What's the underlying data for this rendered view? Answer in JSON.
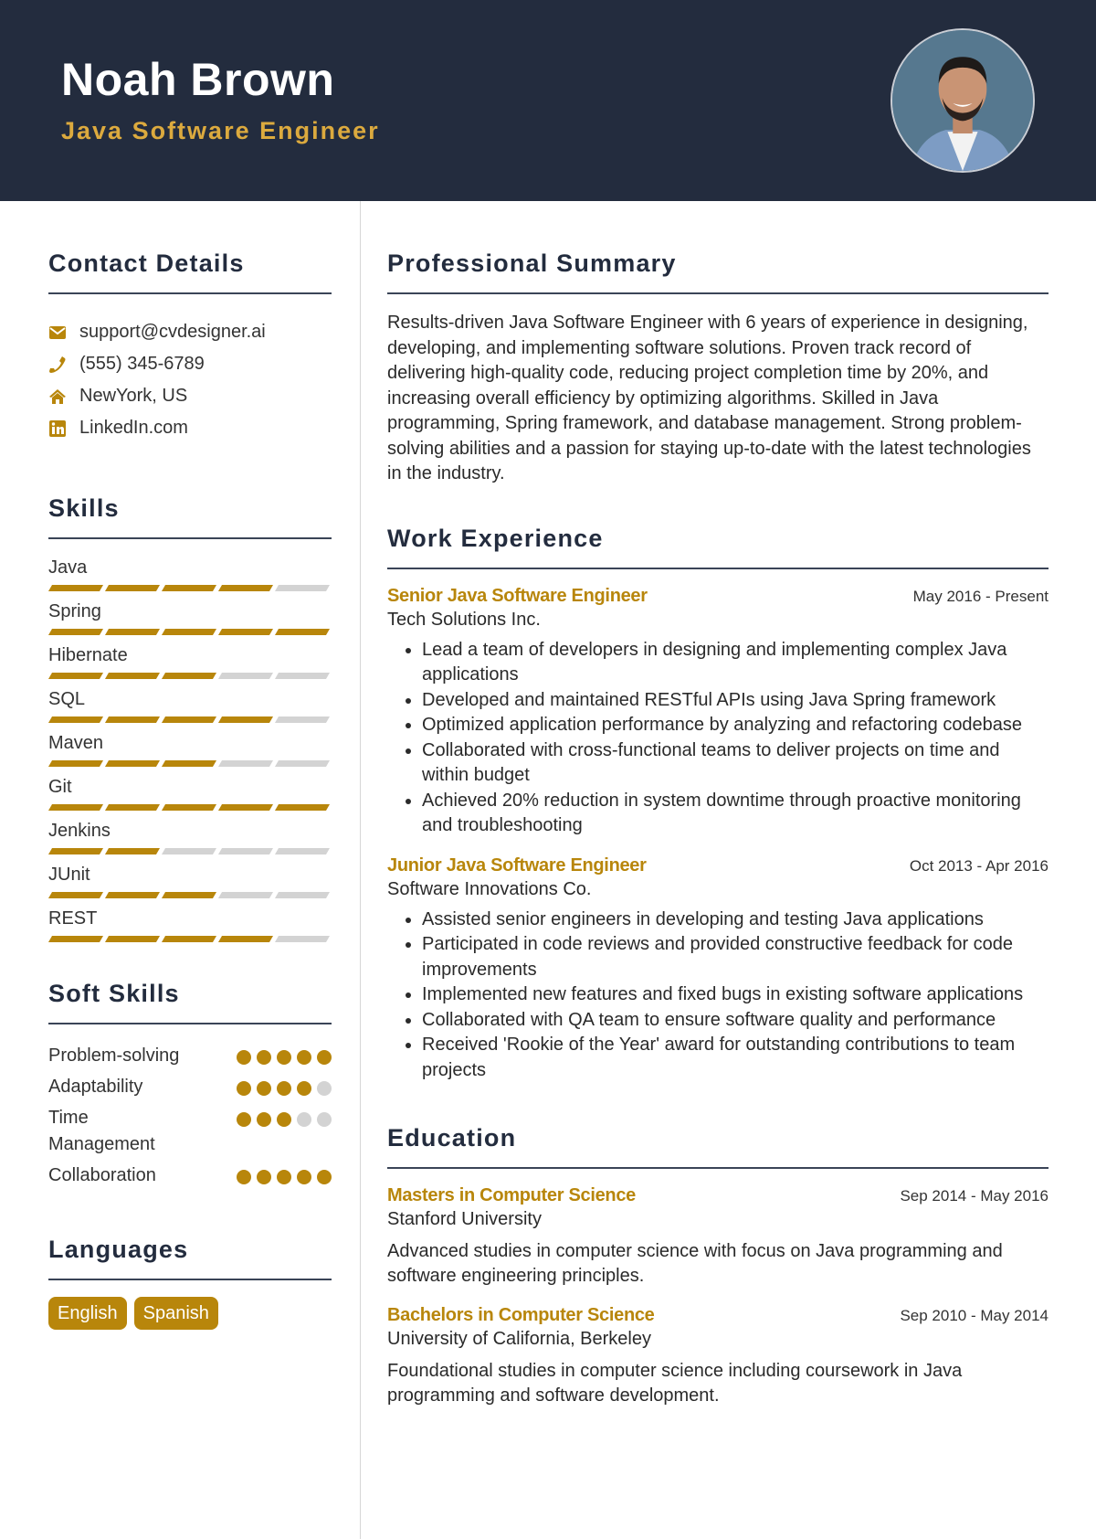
{
  "header": {
    "name": "Noah Brown",
    "role": "Java Software Engineer",
    "accent_color": "#dcaa3e",
    "background_color": "#232c3e"
  },
  "left": {
    "contact": {
      "title": "Contact Details",
      "items": [
        {
          "icon": "envelope-icon",
          "text": "support@cvdesigner.ai"
        },
        {
          "icon": "phone-icon",
          "text": "(555) 345-6789"
        },
        {
          "icon": "home-icon",
          "text": "NewYork, US"
        },
        {
          "icon": "linkedin-icon",
          "text": "LinkedIn.com"
        }
      ]
    },
    "skills": {
      "title": "Skills",
      "max_level": 5,
      "items": [
        {
          "name": "Java",
          "level": 4
        },
        {
          "name": "Spring",
          "level": 5
        },
        {
          "name": "Hibernate",
          "level": 3
        },
        {
          "name": "SQL",
          "level": 4
        },
        {
          "name": "Maven",
          "level": 3
        },
        {
          "name": "Git",
          "level": 5
        },
        {
          "name": "Jenkins",
          "level": 2
        },
        {
          "name": "JUnit",
          "level": 3
        },
        {
          "name": "REST",
          "level": 4
        }
      ]
    },
    "soft_skills": {
      "title": "Soft Skills",
      "max_level": 5,
      "items": [
        {
          "name": "Problem-solving",
          "level": 5
        },
        {
          "name": "Adaptability",
          "level": 4
        },
        {
          "name": "Time Management",
          "level": 3
        },
        {
          "name": "Collaboration",
          "level": 5
        }
      ]
    },
    "languages": {
      "title": "Languages",
      "items": [
        "English",
        "Spanish"
      ]
    }
  },
  "right": {
    "summary": {
      "title": "Professional Summary",
      "text": "Results-driven Java Software Engineer with 6 years of experience in designing, developing, and implementing software solutions. Proven track record of delivering high-quality code, reducing project completion time by 20%, and increasing overall efficiency by optimizing algorithms. Skilled in Java programming, Spring framework, and database management. Strong problem-solving abilities and a passion for staying up-to-date with the latest technologies in the industry."
    },
    "experience": {
      "title": "Work Experience",
      "jobs": [
        {
          "title": "Senior Java Software Engineer",
          "date": "May 2016 - Present",
          "company": "Tech Solutions Inc.",
          "bullets": [
            "Lead a team of developers in designing and implementing complex Java applications",
            "Developed and maintained RESTful APIs using Java Spring framework",
            "Optimized application performance by analyzing and refactoring codebase",
            "Collaborated with cross-functional teams to deliver projects on time and within budget",
            "Achieved 20% reduction in system downtime through proactive monitoring and troubleshooting"
          ]
        },
        {
          "title": "Junior Java Software Engineer",
          "date": "Oct 2013 - Apr 2016",
          "company": "Software Innovations Co.",
          "bullets": [
            "Assisted senior engineers in developing and testing Java applications",
            "Participated in code reviews and provided constructive feedback for code improvements",
            "Implemented new features and fixed bugs in existing software applications",
            "Collaborated with QA team to ensure software quality and performance",
            "Received 'Rookie of the Year' award for outstanding contributions to team projects"
          ]
        }
      ]
    },
    "education": {
      "title": "Education",
      "items": [
        {
          "degree": "Masters in Computer Science",
          "date": "Sep 2014 - May 2016",
          "school": "Stanford University",
          "description": "Advanced studies in computer science with focus on Java programming and software engineering principles."
        },
        {
          "degree": "Bachelors in Computer Science",
          "date": "Sep 2010 - May 2014",
          "school": "University of California, Berkeley",
          "description": "Foundational studies in computer science including coursework in Java programming and software development."
        }
      ]
    }
  }
}
